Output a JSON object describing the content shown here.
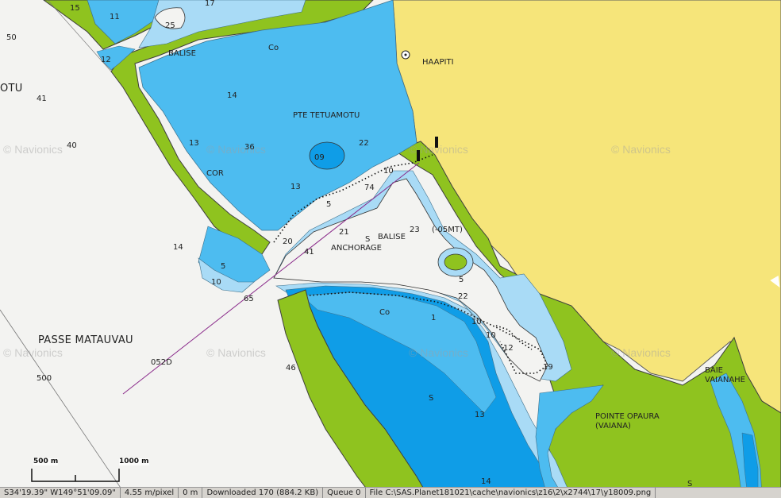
{
  "watermark": "© Navionics",
  "places": {
    "haapiti": "HAAPITI",
    "pte_tetuamotu": "PTE TETUAMOTU",
    "passe_matauvau": "PASSE MATAUVAU",
    "motu": "OTU",
    "balise_top": "BALISE",
    "balise_mid": "BALISE",
    "anchorage": "ANCHORAGE",
    "light": "(-05MT)",
    "pointe_opaura_1": "POINTE OPAURA",
    "pointe_opaura_2": "(VAIANA)",
    "baie_1": "BAIE",
    "baie_2": "VAIANAHE",
    "bearing": "052D",
    "co_1": "Co",
    "co_2": "Co",
    "s_1": "S",
    "s_2": "S",
    "s_3": "S",
    "cor": "COR"
  },
  "soundings": [
    "50",
    "41",
    "40",
    "14",
    "500",
    "46",
    "25",
    "15",
    "11",
    "12",
    "14",
    "13",
    "36",
    "22",
    "09",
    "13",
    "10",
    "74",
    "5",
    "20",
    "21",
    "41",
    "23",
    "5",
    "10",
    "65",
    "22",
    "1",
    "10",
    "10",
    "12",
    "19",
    "13",
    "14",
    "5",
    "17"
  ],
  "scale": {
    "label_1": "500 m",
    "label_2": "1000 m"
  },
  "status_bar": {
    "coords": "S34'19.39\" W149°51'09.09\"",
    "resolution": "4.55 m/pixel",
    "zero": "0 m",
    "downloaded": "Downloaded 170 (884.2 KB)",
    "queue": "Queue 0",
    "file": "File C:\\SAS.Planet181021\\cache\\navionics\\z16\\2\\x2744\\17\\y18009.png"
  },
  "colors": {
    "land": "#f6e57a",
    "shore_green": "#8fc31f",
    "shallow_blue": "#4dbcf0",
    "medium_blue": "#a9dbf6",
    "deep_blue": "#0f9de7",
    "open_water": "#f3f3f1"
  }
}
